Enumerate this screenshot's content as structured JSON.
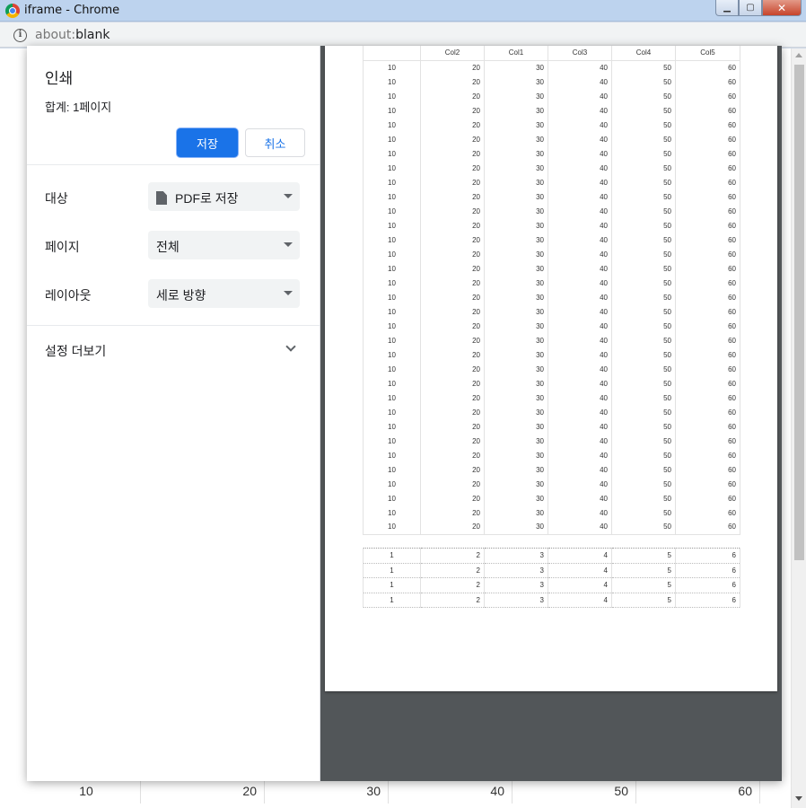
{
  "window": {
    "title": "iframe - Chrome",
    "url_prefix": "about:",
    "url_rest": "blank"
  },
  "print_panel": {
    "title": "인쇄",
    "total": "합계: 1페이지",
    "save_label": "저장",
    "cancel_label": "취소",
    "destination_label": "대상",
    "destination_value": "PDF로 저장",
    "pages_label": "페이지",
    "pages_value": "전체",
    "layout_label": "레이아웃",
    "layout_value": "세로 방향",
    "more_settings": "설정 더보기"
  },
  "preview_table": {
    "headers": [
      "",
      "Col2",
      "Col1",
      "Col3",
      "Col4",
      "Col5"
    ],
    "row": [
      "10",
      "20",
      "30",
      "40",
      "50",
      "60"
    ],
    "row_count": 33,
    "footer_row": [
      "1",
      "2",
      "3",
      "4",
      "5",
      "6"
    ],
    "footer_count": 4
  },
  "background_row": [
    "10",
    "20",
    "30",
    "40",
    "50",
    "60"
  ],
  "colors": {
    "accent": "#1a73e8",
    "preview_bg": "#525659"
  }
}
